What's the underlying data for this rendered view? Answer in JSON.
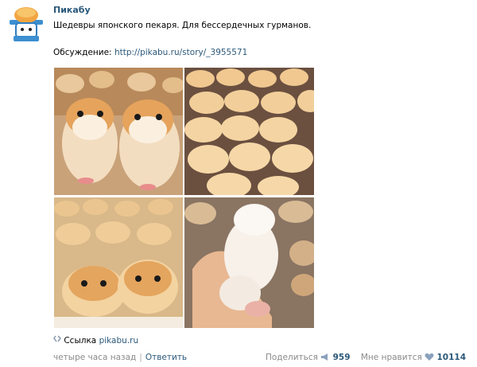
{
  "post": {
    "author": "Пикабу",
    "text": "Шедевры японского пекаря. Для бессердечных гурманов.",
    "discussion_label": "Обсуждение:",
    "discussion_url": "http://pikabu.ru/story/_3955571"
  },
  "attachment": {
    "label": "Ссылка",
    "domain": "pikabu.ru"
  },
  "footer": {
    "time": "четыре часа назад",
    "separator": "|",
    "reply": "Ответить",
    "share_label": "Поделиться",
    "share_count": "959",
    "like_label": "Мне нравится",
    "like_count": "10114"
  },
  "colors": {
    "link": "#2b587a",
    "muted": "#8a8a8a"
  }
}
